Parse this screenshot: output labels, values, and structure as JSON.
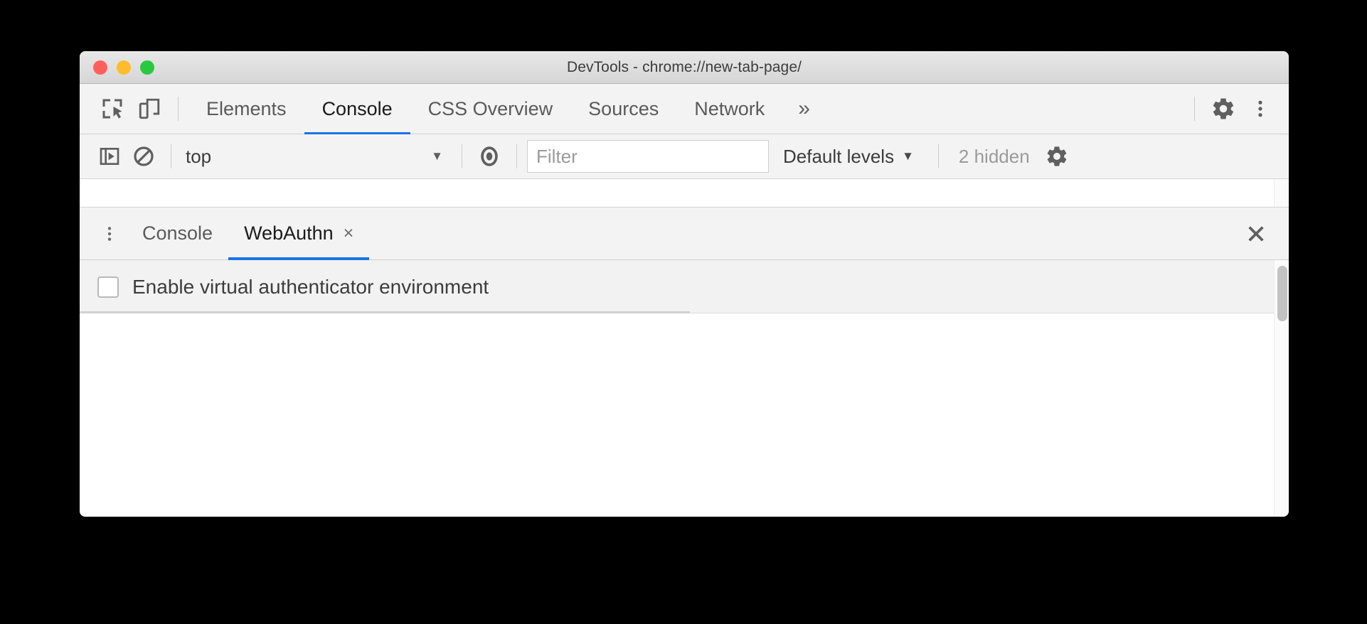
{
  "window": {
    "title": "DevTools - chrome://new-tab-page/",
    "traffic_lights": [
      {
        "name": "close",
        "color": "#ff605c"
      },
      {
        "name": "minimize",
        "color": "#ffbd2e"
      },
      {
        "name": "zoom",
        "color": "#28c940"
      }
    ]
  },
  "main_tabbar": {
    "inspect_icon": "inspect-element-icon",
    "device_icon": "device-toolbar-icon",
    "tabs": [
      {
        "label": "Elements",
        "active": false
      },
      {
        "label": "Console",
        "active": true
      },
      {
        "label": "CSS Overview",
        "active": false
      },
      {
        "label": "Sources",
        "active": false
      },
      {
        "label": "Network",
        "active": false
      }
    ],
    "more_tabs_label": "»",
    "settings_icon": "gear-icon",
    "more_options_icon": "three-dot-vertical-icon"
  },
  "console_toolbar": {
    "sidebar_toggle_icon": "console-sidebar-icon",
    "clear_console_icon": "clear-console-icon",
    "context": {
      "value": "top",
      "caret": "▼"
    },
    "live_expression_icon": "eye-icon",
    "filter": {
      "value": "",
      "placeholder": "Filter"
    },
    "levels": {
      "label": "Default levels",
      "caret": "▼"
    },
    "hidden_count": "2 hidden",
    "settings_icon": "gear-icon"
  },
  "drawer": {
    "more_options_icon": "three-dot-vertical-icon",
    "tabs": [
      {
        "label": "Console",
        "active": false,
        "closable": false
      },
      {
        "label": "WebAuthn",
        "active": true,
        "closable": true,
        "close_label": "×"
      }
    ],
    "close_drawer_icon": "close-icon",
    "close_drawer_label": "✕"
  },
  "webauthn_panel": {
    "enable_checkbox": {
      "label": "Enable virtual authenticator environment",
      "checked": false
    }
  },
  "colors": {
    "accent": "#1a73e8",
    "toolbar_bg": "#f3f3f3",
    "panel_bg": "#ffffff",
    "row_bg": "#f2f2f2",
    "text": "#3c3c3c",
    "muted_text": "#9a9a9a"
  }
}
